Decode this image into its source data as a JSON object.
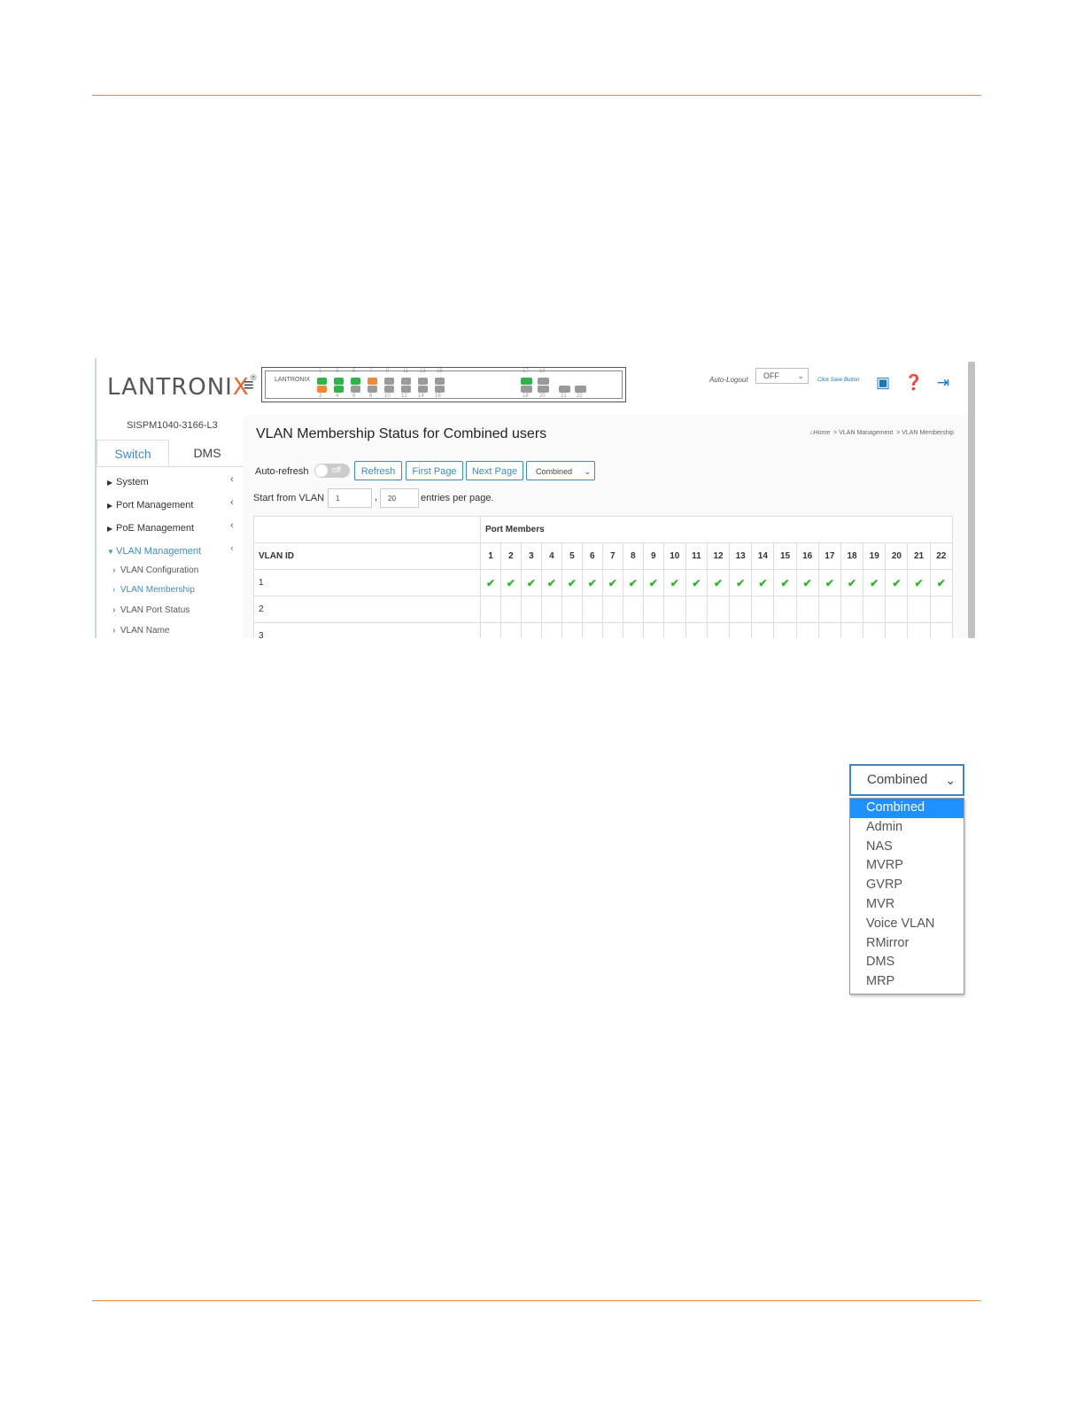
{
  "brand": {
    "name_main": "LANTRONI",
    "name_x": "X",
    "reg": "®"
  },
  "device_panel": {
    "logo": "LANTRONIX",
    "top_numbers": [
      "1",
      "3",
      "5",
      "7",
      "9",
      "11",
      "13",
      "15",
      "17",
      "19"
    ],
    "bottom_numbers": [
      "2",
      "4",
      "6",
      "8",
      "10",
      "12",
      "14",
      "16",
      "18",
      "20",
      "21",
      "22"
    ]
  },
  "topbar": {
    "autologout_label": "Auto-Logout",
    "autologout_value": "OFF",
    "save_hint": "Click Save Button"
  },
  "sidebar": {
    "model": "SISPM1040-3166-L3",
    "tabs": [
      "Switch",
      "DMS"
    ],
    "menu": [
      {
        "label": "System"
      },
      {
        "label": "Port Management"
      },
      {
        "label": "PoE Management"
      },
      {
        "label": "VLAN Management"
      }
    ],
    "submenu": [
      "VLAN Configuration",
      "VLAN Membership",
      "VLAN Port Status",
      "VLAN Name"
    ]
  },
  "page": {
    "title": "VLAN Membership Status for Combined users",
    "breadcrumb": [
      "Home",
      "VLAN Management",
      "VLAN Membership"
    ],
    "autorefresh_label": "Auto-refresh",
    "toggle_label": "off",
    "buttons": {
      "refresh": "Refresh",
      "first": "First Page",
      "next": "Next Page"
    },
    "user_select": "Combined",
    "start_label": "Start from VLAN",
    "start_value": "1",
    "comma": ",",
    "entries_value": "20",
    "entries_label": "entries per page."
  },
  "table": {
    "group_header": "Port Members",
    "vlan_header": "VLAN ID",
    "ports": [
      "1",
      "2",
      "3",
      "4",
      "5",
      "6",
      "7",
      "8",
      "9",
      "10",
      "11",
      "12",
      "13",
      "14",
      "15",
      "16",
      "17",
      "18",
      "19",
      "20",
      "21",
      "22"
    ],
    "rows": [
      {
        "id": "1",
        "members": [
          1,
          1,
          1,
          1,
          1,
          1,
          1,
          1,
          1,
          1,
          1,
          1,
          1,
          1,
          1,
          1,
          1,
          1,
          1,
          1,
          1,
          1
        ]
      },
      {
        "id": "2",
        "members": [
          0,
          0,
          0,
          0,
          0,
          0,
          0,
          0,
          0,
          0,
          0,
          0,
          0,
          0,
          0,
          0,
          0,
          0,
          0,
          0,
          0,
          0
        ]
      },
      {
        "id": "3",
        "members": [
          0,
          0,
          0,
          0,
          0,
          0,
          0,
          0,
          0,
          0,
          0,
          0,
          0,
          0,
          0,
          0,
          0,
          0,
          0,
          0,
          0,
          0
        ]
      }
    ],
    "check_glyph": "✔"
  },
  "dropdown": {
    "value": "Combined",
    "options": [
      "Combined",
      "Admin",
      "NAS",
      "MVRP",
      "GVRP",
      "MVR",
      "Voice VLAN",
      "RMirror",
      "DMS",
      "MRP"
    ],
    "selected_index": 0
  },
  "colors": {
    "accent": "#3c8dbc",
    "rule": "#e08a4a",
    "check": "#2db52d",
    "port_green": "#2eb44a",
    "port_orange": "#f0883a",
    "port_gray": "#9a9a9a"
  }
}
